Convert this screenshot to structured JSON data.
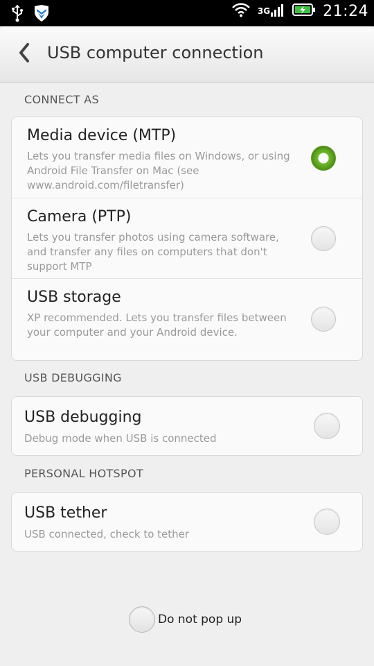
{
  "status_bar": {
    "network": "3G",
    "time": "21:24",
    "icons": [
      "usb-icon",
      "shield-app-icon",
      "wifi-icon",
      "signal-icon",
      "battery-charging-icon"
    ]
  },
  "header": {
    "title": "USB computer connection",
    "back_icon": "chevron-left-icon"
  },
  "sections": {
    "connect_as": {
      "label": "CONNECT AS",
      "items": [
        {
          "title": "Media device (MTP)",
          "description": "Lets you transfer media files on Windows, or using Android File Transfer on Mac (see www.android.com/filetransfer)",
          "selected": true
        },
        {
          "title": "Camera (PTP)",
          "description": "Lets you transfer photos using camera software, and transfer any files on computers that don't support MTP",
          "selected": false
        },
        {
          "title": "USB storage",
          "description": "XP recommended. Lets you transfer files between your computer and your Android device.",
          "selected": false
        }
      ]
    },
    "usb_debugging": {
      "label": "USB DEBUGGING",
      "item": {
        "title": "USB debugging",
        "description": "Debug mode when USB is connected",
        "checked": false
      }
    },
    "personal_hotspot": {
      "label": "PERSONAL HOTSPOT",
      "item": {
        "title": "USB tether",
        "description": "USB connected, check to tether",
        "checked": false
      }
    }
  },
  "footer": {
    "do_not_popup_label": "Do not pop up",
    "checked": false
  },
  "colors": {
    "accent_green": "#6fba2c",
    "background": "#efefef",
    "card": "#fafafa",
    "status_bar": "#000000"
  }
}
